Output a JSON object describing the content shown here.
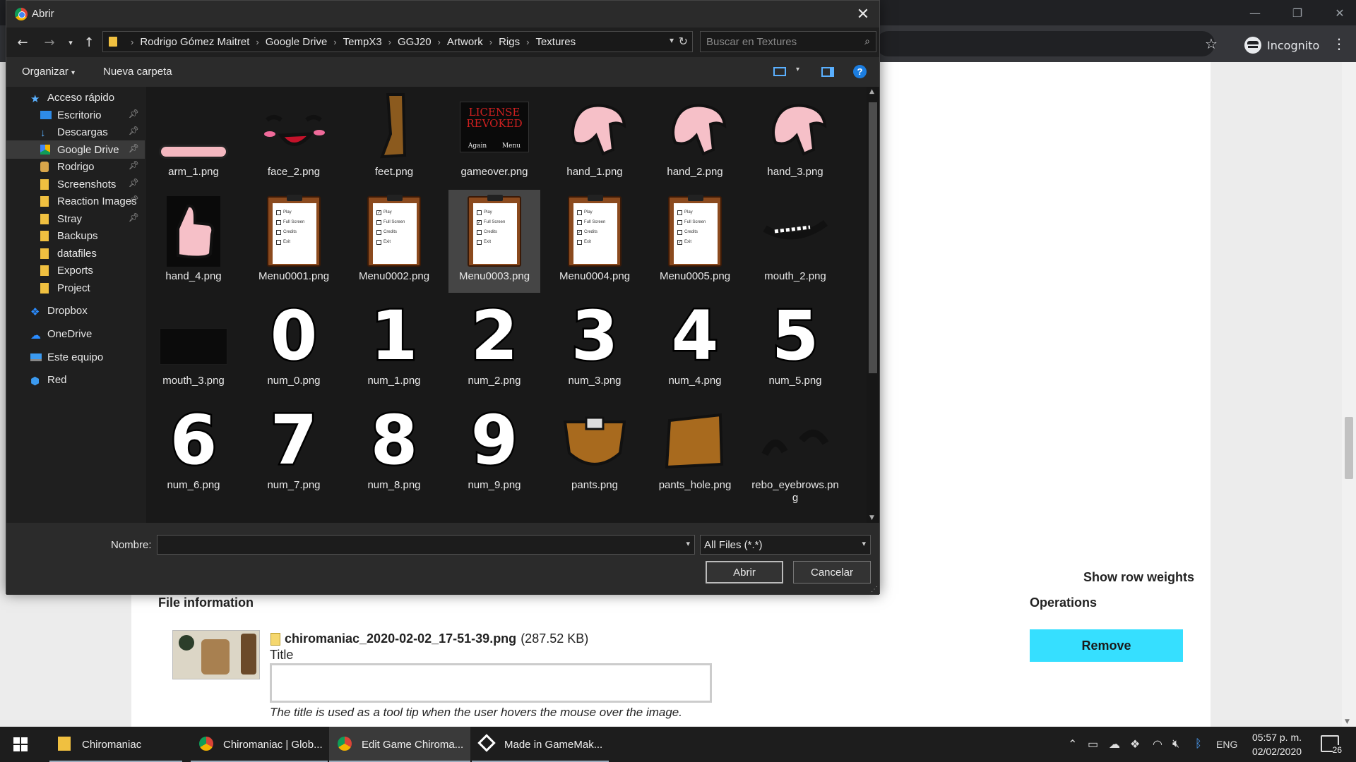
{
  "dialog": {
    "title": "Abrir",
    "breadcrumbs": [
      "Rodrigo Gómez Maitret",
      "Google Drive",
      "TempX3",
      "GGJ20",
      "Artwork",
      "Rigs",
      "Textures"
    ],
    "search_placeholder": "Buscar en Textures",
    "toolbar": {
      "organize": "Organizar",
      "new_folder": "Nueva carpeta"
    },
    "sidebar": [
      {
        "label": "Acceso rápido",
        "icon": "star-icon",
        "pinned": false,
        "selected": false
      },
      {
        "label": "Escritorio",
        "icon": "desktop-icon",
        "pinned": true,
        "selected": false
      },
      {
        "label": "Descargas",
        "icon": "download-icon",
        "pinned": true,
        "selected": false
      },
      {
        "label": "Google Drive",
        "icon": "google-drive-icon",
        "pinned": true,
        "selected": true
      },
      {
        "label": "Rodrigo",
        "icon": "user-folder-icon",
        "pinned": true,
        "selected": false
      },
      {
        "label": "Screenshots",
        "icon": "folder-icon",
        "pinned": true,
        "selected": false
      },
      {
        "label": "Reaction Images",
        "icon": "folder-icon",
        "pinned": true,
        "selected": false
      },
      {
        "label": "Stray",
        "icon": "folder-icon",
        "pinned": true,
        "selected": false
      },
      {
        "label": "Backups",
        "icon": "folder-icon",
        "pinned": false,
        "selected": false
      },
      {
        "label": "datafiles",
        "icon": "folder-icon",
        "pinned": false,
        "selected": false
      },
      {
        "label": "Exports",
        "icon": "folder-icon",
        "pinned": false,
        "selected": false
      },
      {
        "label": "Project",
        "icon": "folder-icon",
        "pinned": false,
        "selected": false
      },
      {
        "label": "Dropbox",
        "icon": "dropbox-icon",
        "pinned": false,
        "selected": false
      },
      {
        "label": "OneDrive",
        "icon": "onedrive-icon",
        "pinned": false,
        "selected": false
      },
      {
        "label": "Este equipo",
        "icon": "computer-icon",
        "pinned": false,
        "selected": false
      },
      {
        "label": "Red",
        "icon": "network-icon",
        "pinned": false,
        "selected": false
      }
    ],
    "files": [
      {
        "name": "arm_1.png",
        "thumb": "arm"
      },
      {
        "name": "face_2.png",
        "thumb": "face"
      },
      {
        "name": "feet.png",
        "thumb": "feet"
      },
      {
        "name": "gameover.png",
        "thumb": "gameover"
      },
      {
        "name": "hand_1.png",
        "thumb": "hand"
      },
      {
        "name": "hand_2.png",
        "thumb": "hand"
      },
      {
        "name": "hand_3.png",
        "thumb": "hand"
      },
      {
        "name": "hand_4.png",
        "thumb": "thumb-up"
      },
      {
        "name": "Menu0001.png",
        "thumb": "clipboard"
      },
      {
        "name": "Menu0002.png",
        "thumb": "clipboard"
      },
      {
        "name": "Menu0003.png",
        "thumb": "clipboard",
        "selected": true
      },
      {
        "name": "Menu0004.png",
        "thumb": "clipboard"
      },
      {
        "name": "Menu0005.png",
        "thumb": "clipboard"
      },
      {
        "name": "mouth_2.png",
        "thumb": "mouth"
      },
      {
        "name": "mouth_3.png",
        "thumb": "mouth3"
      },
      {
        "name": "num_0.png",
        "thumb": "digit",
        "glyph": "0"
      },
      {
        "name": "num_1.png",
        "thumb": "digit",
        "glyph": "1"
      },
      {
        "name": "num_2.png",
        "thumb": "digit",
        "glyph": "2"
      },
      {
        "name": "num_3.png",
        "thumb": "digit",
        "glyph": "3"
      },
      {
        "name": "num_4.png",
        "thumb": "digit",
        "glyph": "4"
      },
      {
        "name": "num_5.png",
        "thumb": "digit",
        "glyph": "5"
      },
      {
        "name": "num_6.png",
        "thumb": "digit",
        "glyph": "6"
      },
      {
        "name": "num_7.png",
        "thumb": "digit",
        "glyph": "7"
      },
      {
        "name": "num_8.png",
        "thumb": "digit",
        "glyph": "8"
      },
      {
        "name": "num_9.png",
        "thumb": "digit",
        "glyph": "9"
      },
      {
        "name": "pants.png",
        "thumb": "pants"
      },
      {
        "name": "pants_hole.png",
        "thumb": "pants-hole"
      },
      {
        "name": "rebo_eyebrows.png",
        "thumb": "eyebrows"
      }
    ],
    "gameover_text": {
      "line1": "LICENSE",
      "line2": "REVOKED",
      "again": "Again",
      "menu": "Menu"
    },
    "menu_items": [
      "Play",
      "Full Screen",
      "Credits",
      "Exit"
    ],
    "name_label": "Nombre:",
    "name_value": "",
    "filetype": "All Files (*.*)",
    "open_button": "Abrir",
    "cancel_button": "Cancelar"
  },
  "browser": {
    "incognito_label": "Incognito"
  },
  "page": {
    "show_row_weights": "Show row weights",
    "operations_heading": "Operations",
    "remove_button": "Remove",
    "file_info_heading": "File information",
    "file_name": "chiromaniac_2020-02-02_17-51-39.png",
    "file_size": "(287.52 KB)",
    "title_label": "Title",
    "title_value": "",
    "title_help": "The title is used as a tool tip when the user hovers the mouse over the image."
  },
  "taskbar": {
    "items": [
      {
        "label": "Chiromaniac",
        "icon": "folder-icon",
        "active": false
      },
      {
        "label": "Chiromaniac | Glob...",
        "icon": "chrome-icon",
        "active": false
      },
      {
        "label": "Edit Game Chiroma...",
        "icon": "chrome-icon",
        "active": true
      },
      {
        "label": "Made in GameMak...",
        "icon": "gamemaker-icon",
        "active": false
      }
    ],
    "language": "ENG",
    "time": "05:57 p. m.",
    "date": "02/02/2020",
    "notifications": "26"
  },
  "colors": {
    "dialog_bg": "#1f1f1f",
    "accent_button": "#36dfff",
    "selection": "#454545"
  }
}
